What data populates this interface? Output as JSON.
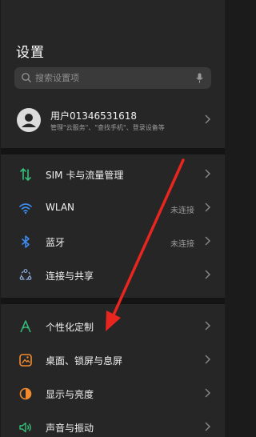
{
  "page": {
    "title": "设置"
  },
  "search": {
    "placeholder": "搜索设置项"
  },
  "account": {
    "name": "用户01346531618",
    "subtitle": "管理\"云服务\"、\"查找手机\"、登录设备等"
  },
  "groups": [
    [
      {
        "label": "SIM 卡与流量管理",
        "status": "",
        "icon": "sim-traffic-icon"
      },
      {
        "label": "WLAN",
        "status": "未连接",
        "icon": "wifi-icon"
      },
      {
        "label": "蓝牙",
        "status": "未连接",
        "icon": "bluetooth-icon"
      },
      {
        "label": "连接与共享",
        "status": "",
        "icon": "share-icon"
      }
    ],
    [
      {
        "label": "个性化定制",
        "status": "",
        "icon": "personalize-icon"
      },
      {
        "label": "桌面、锁屏与息屏",
        "status": "",
        "icon": "desktop-icon"
      },
      {
        "label": "显示与亮度",
        "status": "",
        "icon": "brightness-icon"
      },
      {
        "label": "声音与振动",
        "status": "",
        "icon": "sound-icon"
      }
    ]
  ],
  "colors": {
    "background": "#262626",
    "arrow": "#e8251f"
  }
}
